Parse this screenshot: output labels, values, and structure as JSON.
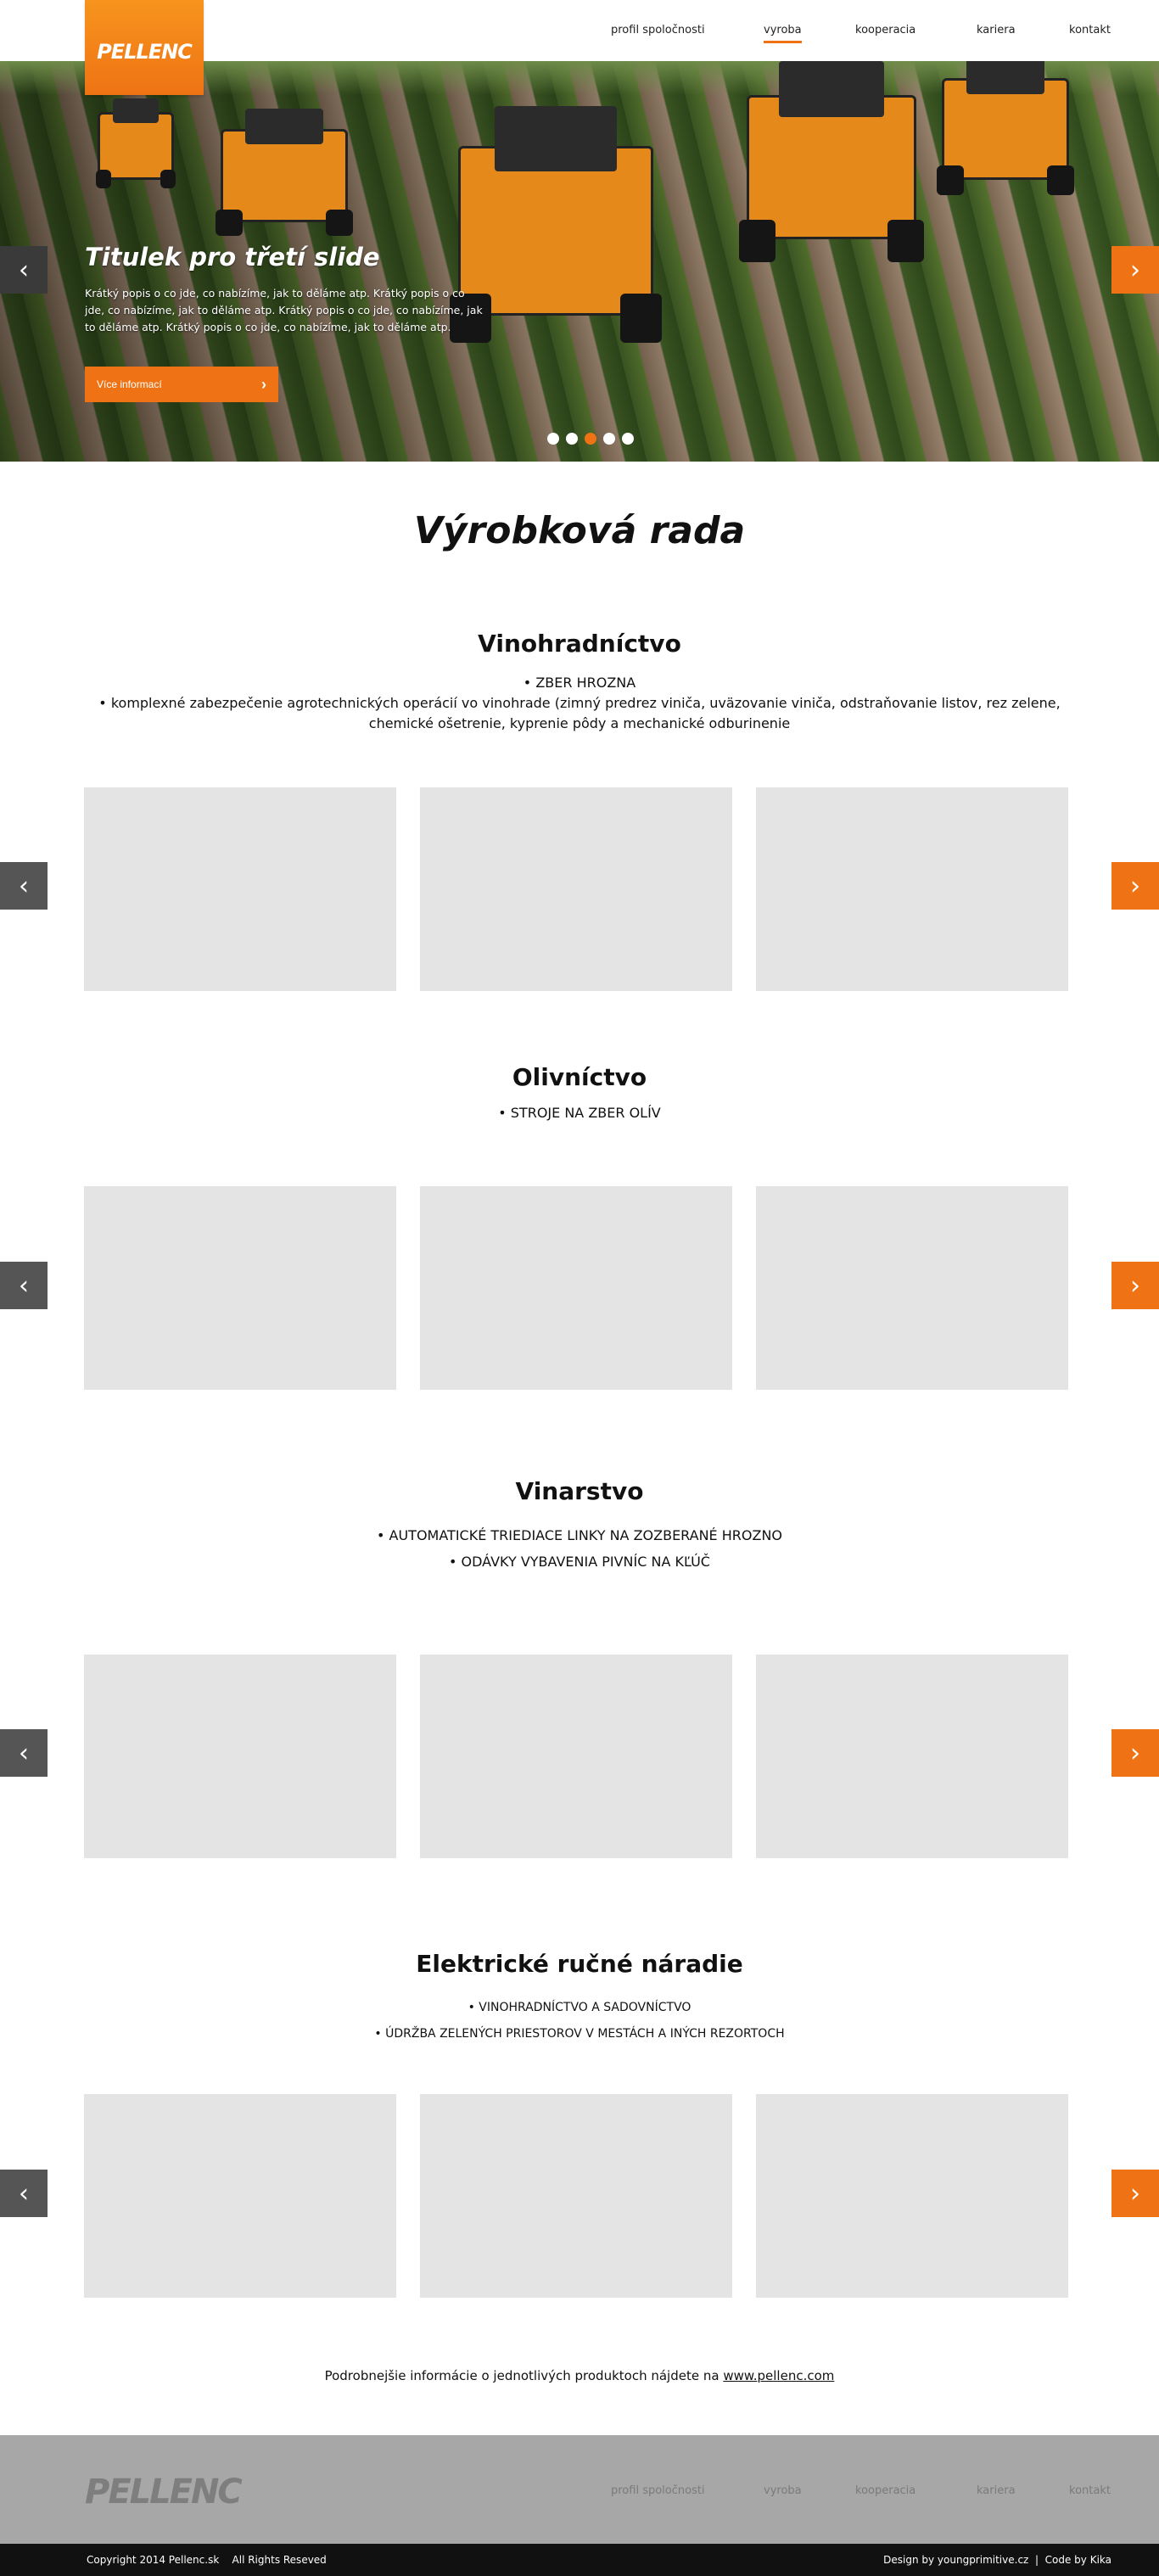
{
  "header": {
    "logo": "PELLENC",
    "nav": [
      {
        "label": "profil spoločnosti"
      },
      {
        "label": "vyroba"
      },
      {
        "label": "kooperacia"
      },
      {
        "label": "kariera"
      },
      {
        "label": "kontakt"
      }
    ],
    "active_nav": "vyroba"
  },
  "hero": {
    "title": "Titulek pro třetí slide",
    "description": "Krátký popis o co jde, co nabízíme, jak to děláme atp. Krátký popis o co jde, co nabízíme, jak to děláme atp. Krátký popis o co jde, co nabízíme, jak to děláme atp. Krátký popis o co jde, co nabízíme, jak to děláme atp.",
    "button_label": "Více informací",
    "active_slide": 3,
    "slide_count": 5
  },
  "page_title": "Výrobková rada",
  "sections": [
    {
      "title": "Vinohradníctvo",
      "items": [
        "ZBER HROZNA",
        "komplexné zabezpečenie agrotechnických operácií vo vinohrade (zimný predrez viniča, uväzovanie viniča, odstraňovanie listov, rez zelene, chemické ošetrenie, kyprenie pôdy a mechanické odburinenie"
      ]
    },
    {
      "title": "Olivníctvo",
      "items": [
        "STROJE NA ZBER OLÍV"
      ]
    },
    {
      "title": "Vinarstvo",
      "items": [
        "AUTOMATICKÉ TRIEDIACE LINKY NA ZOZBERANÉ HROZNO",
        "ODÁVKY VYBAVENIA PIVNÍC NA KĽÚČ"
      ]
    },
    {
      "title": "Elektrické ručné náradie",
      "items": [
        "VINOHRADNÍCTVO A SADOVNÍCTVO",
        "ÚDRŽBA ZELENÝCH PRIESTOROV V MESTÁCH A INÝCH REZORTOCH"
      ]
    }
  ],
  "more_info": {
    "text": "Podrobnejšie informácie o jednotlivých produktoch nájdete na ",
    "link": "www.pellenc.com"
  },
  "footer": {
    "logo": "PELLENC",
    "nav": [
      "profil spoločnosti",
      "vyroba",
      "kooperacia",
      "kariera",
      "kontakt"
    ],
    "copyright": "Copyright 2014 Pellenc.sk    All Rights Reseved",
    "credits": "Design by youngprimitive.cz  |  Code by Kika"
  },
  "icons": {
    "prev": "chevron-left-icon",
    "next": "chevron-right-icon"
  },
  "colors": {
    "accent": "#ef7314",
    "dark_arrow": "#3a3a3a",
    "placeholder": "#e4e4e4",
    "footer_bg": "#a7a7a7",
    "bottom_bar": "#111111"
  }
}
